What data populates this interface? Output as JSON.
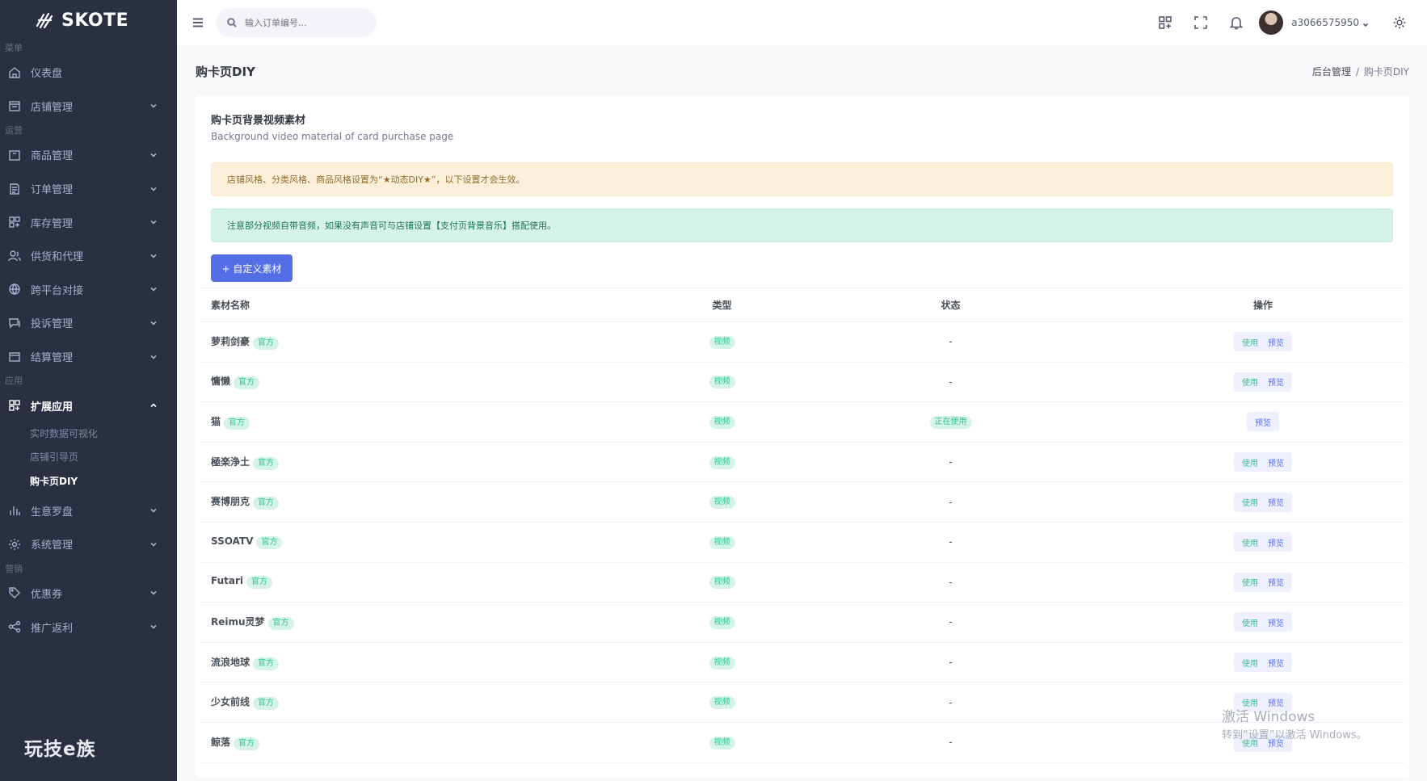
{
  "brand": {
    "name": "SKOTE"
  },
  "sidebar": {
    "sections": {
      "menu": "菜单",
      "operations": "运营",
      "apps": "应用",
      "marketing": "营销"
    },
    "items": {
      "dashboard": "仪表盘",
      "store": "店铺管理",
      "products": "商品管理",
      "orders": "订单管理",
      "inventory": "库存管理",
      "supply": "供货和代理",
      "crossplatform": "跨平台对接",
      "complaints": "投诉管理",
      "settlement": "结算管理",
      "extensions": "扩展应用",
      "business": "生意罗盘",
      "system": "系统管理",
      "coupons": "优惠券",
      "referral": "推广返利"
    },
    "sub_items": {
      "realtime": "实时数据可视化",
      "guide": "店铺引导页",
      "carddiy": "购卡页DIY"
    },
    "footer": "玩技e族"
  },
  "topbar": {
    "search_placeholder": "输入订单编号...",
    "username": "a3066575950"
  },
  "page": {
    "title": "购卡页DIY",
    "breadcrumb": [
      "后台管理",
      "购卡页DIY"
    ]
  },
  "card": {
    "title": "购卡页背景视频素材",
    "subtitle": "Background video material of card purchase page",
    "alert_warning": "店铺风格、分类风格、商品风格设置为“★动态DIY★”，以下设置才会生效。",
    "alert_info": "注意部分视频自带音频，如果没有声音可与店铺设置【支付页背景音乐】搭配使用。",
    "add_button": "+ 自定义素材"
  },
  "table": {
    "headers": {
      "name": "素材名称",
      "type": "类型",
      "status": "状态",
      "ops": "操作"
    },
    "official_label": "官方",
    "type_label": "视频",
    "use_label": "使用",
    "preview_label": "预览",
    "rows": [
      {
        "name": "萝莉剑豪",
        "status": "-"
      },
      {
        "name": "慵懒",
        "status": "-"
      },
      {
        "name": "猫",
        "status": "正在使用"
      },
      {
        "name": "極楽浄土",
        "status": "-"
      },
      {
        "name": "赛博朋克",
        "status": "-"
      },
      {
        "name": "SSOATV",
        "status": "-"
      },
      {
        "name": "Futari",
        "status": "-"
      },
      {
        "name": "Reimu灵梦",
        "status": "-"
      },
      {
        "name": "流浪地球",
        "status": "-"
      },
      {
        "name": "少女前线",
        "status": "-"
      },
      {
        "name": "鲸落",
        "status": "-"
      }
    ]
  },
  "watermark": {
    "line1": "激活 Windows",
    "line2": "转到“设置”以激活 Windows。"
  },
  "colors": {
    "sidebar_bg": "#2a3042",
    "primary": "#556ee6",
    "success": "#34c38f"
  }
}
